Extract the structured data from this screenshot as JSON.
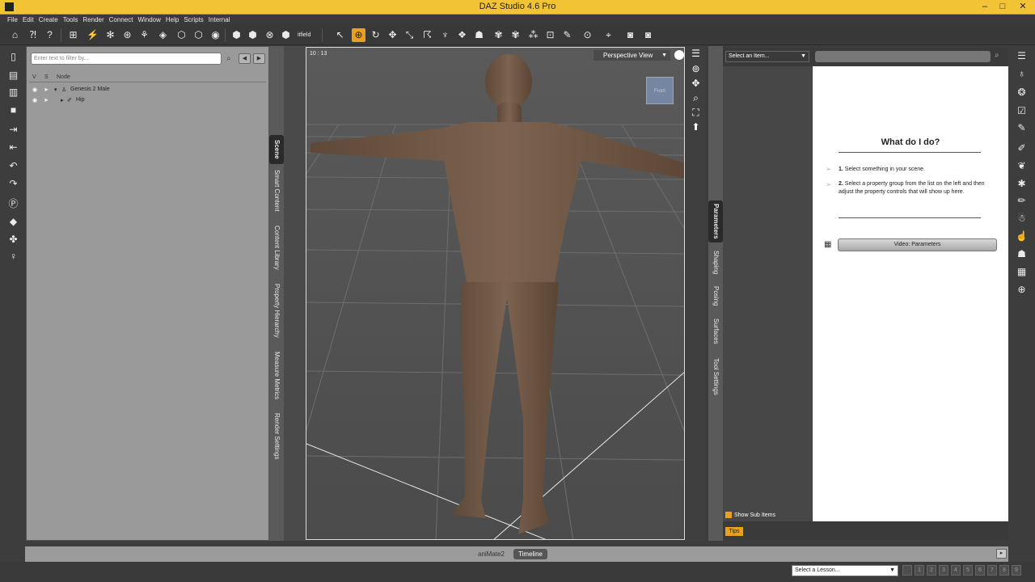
{
  "window": {
    "title": "DAZ Studio 4.6 Pro",
    "minimize": "–",
    "maximize": "□",
    "close": "✕"
  },
  "menu": [
    "File",
    "Edit",
    "Create",
    "Tools",
    "Render",
    "Connect",
    "Window",
    "Help",
    "Scripts",
    "Internal"
  ],
  "toolbar": {
    "text": "itfield"
  },
  "scene": {
    "filter_placeholder": "Enter text to filter by...",
    "columns": {
      "v": "V",
      "s": "S",
      "node": "Node"
    },
    "nodes": [
      {
        "expander": "▾",
        "label": "Genesis 2 Male"
      },
      {
        "expander": "▸",
        "label": "Hip"
      }
    ]
  },
  "left_tabs": [
    "Scene",
    "Smart Content",
    "Content Library",
    "Property Hierarchy",
    "Measure Metrics",
    "Render Settings"
  ],
  "viewport": {
    "fps": "10 : 13",
    "view": "Perspective View",
    "cube_label": "Front"
  },
  "right_tabs": [
    "Parameters",
    "Shaping",
    "Posing",
    "Surfaces",
    "Tool Settings"
  ],
  "params": {
    "item_select": "Select an Item...",
    "show_sub_items": "Show Sub Items",
    "help_title": "What do I do?",
    "step1_num": "1.",
    "step1": "Select something in your scene.",
    "step2_num": "2.",
    "step2": "Select a property group from the list on the left and then adjust the property controls that will show up here.",
    "video_button": "Video: Parameters",
    "tips": "Tips"
  },
  "timeline": {
    "tabs": [
      "aniMate2",
      "Timeline"
    ]
  },
  "status": {
    "lesson_select": "Select a Lesson...",
    "pages": [
      "1",
      "2",
      "3",
      "4",
      "5",
      "6",
      "7",
      "8",
      "9"
    ]
  },
  "colors": {
    "accent": "#e8a020",
    "titlebar": "#f2c335",
    "panel_bg": "#9a9a9a"
  },
  "icons": {
    "toolbar": [
      "select-icon",
      "rotate-icon",
      "translate-icon",
      "scale-icon",
      "camera-icon"
    ],
    "viewport_nav": [
      "pan-icon",
      "zoom-icon",
      "frame-icon",
      "orbit-icon"
    ]
  }
}
